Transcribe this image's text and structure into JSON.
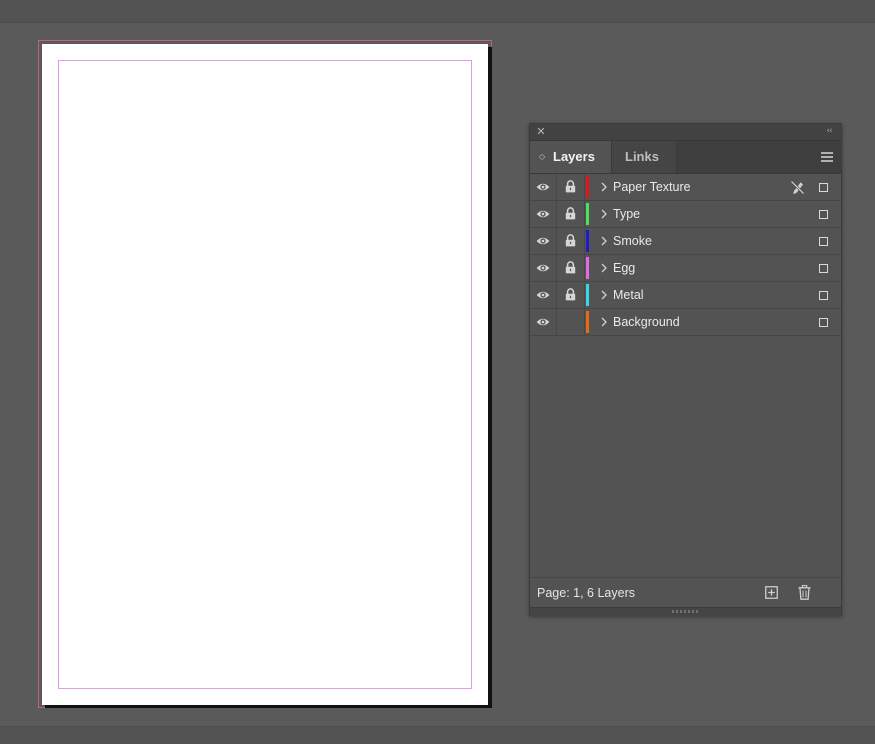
{
  "panel": {
    "tabs": [
      {
        "label": "Layers",
        "active": true
      },
      {
        "label": "Links",
        "active": false
      }
    ],
    "icons": {
      "close": "close-icon",
      "collapse": "collapse-icon",
      "menu": "panel-menu-icon"
    }
  },
  "layers": [
    {
      "name": "Paper Texture",
      "color": "#e0161b",
      "visible": true,
      "locked": true,
      "no_draw": true
    },
    {
      "name": "Type",
      "color": "#4fe05a",
      "visible": true,
      "locked": true,
      "no_draw": false
    },
    {
      "name": "Smoke",
      "color": "#1c1ccc",
      "visible": true,
      "locked": true,
      "no_draw": false
    },
    {
      "name": "Egg",
      "color": "#e46ae6",
      "visible": true,
      "locked": true,
      "no_draw": false
    },
    {
      "name": "Metal",
      "color": "#33d9e6",
      "visible": true,
      "locked": true,
      "no_draw": false
    },
    {
      "name": "Background",
      "color": "#e86a12",
      "visible": true,
      "locked": false,
      "no_draw": false
    }
  ],
  "footer": {
    "page_info": "Page: 1, 6 Layers"
  },
  "colors": {
    "workspace": "#5a5a5a",
    "panel": "#535353",
    "margin_guide": "#e09be6",
    "bleed_guide": "#c0608a"
  }
}
